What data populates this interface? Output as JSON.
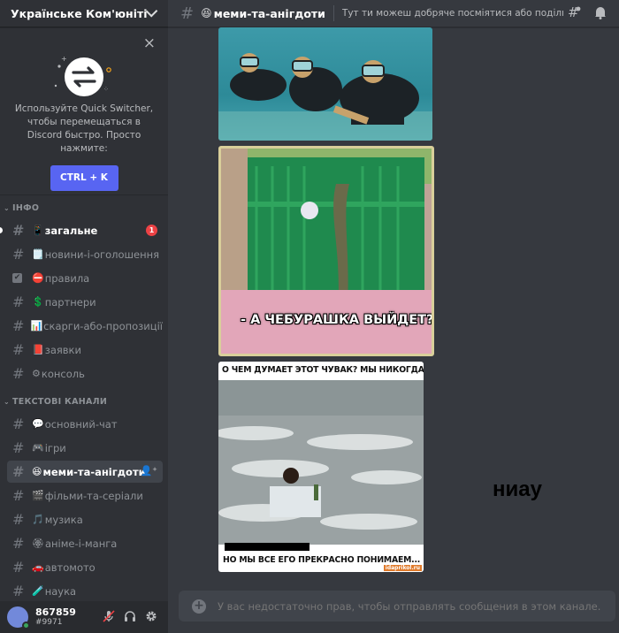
{
  "guild": {
    "name": "Українське Ком'юніті"
  },
  "quick_switcher": {
    "text": "Используйте Quick Switcher, чтобы перемещаться в Discord быстро. Просто нажмите:",
    "button": "CTRL + K",
    "close": "×"
  },
  "categories": [
    {
      "name": "ІНФО",
      "arrow": "⌄"
    },
    {
      "name": "ТЕКСТОВІ КАНАЛИ",
      "arrow": "⌄"
    }
  ],
  "info_channels": [
    {
      "emoji": "📱",
      "name": "загальне",
      "badge": "1"
    },
    {
      "emoji": "🗒️",
      "name": "новини-і-оголошення"
    },
    {
      "emoji": "⛔",
      "name": "правила"
    },
    {
      "emoji": "💲",
      "name": "партнери"
    },
    {
      "emoji": "📊",
      "name": "скарги-або-пропозиції"
    },
    {
      "emoji": "📕",
      "name": "заявки"
    },
    {
      "emoji": "⚙",
      "name": "консоль"
    }
  ],
  "text_channels": [
    {
      "emoji": "💬",
      "name": "основний-чат"
    },
    {
      "emoji": "🎮",
      "name": "ігри"
    },
    {
      "emoji": "😆",
      "name": "меми-та-анігдоти"
    },
    {
      "emoji": "🎬",
      "name": "фільми-та-серіали"
    },
    {
      "emoji": "🎵",
      "name": "музика"
    },
    {
      "emoji": "🏵",
      "name": "аніме-і-манга"
    },
    {
      "emoji": "🚗",
      "name": "автомото"
    },
    {
      "emoji": "🧪",
      "name": "наука"
    }
  ],
  "user": {
    "name": "867859",
    "tag": "#9971"
  },
  "channel_header": {
    "hash": "#",
    "emoji": "😆",
    "name": "меми-та-анігдоти",
    "topic": "Тут ти можеш добряче посміятися або поділитис..."
  },
  "memes": {
    "crocodile_caption": "- А ЧЕБУРАШКА ВЫЙДЕТ?",
    "sea_top": "О ЧЕМ ДУМАЕТ ЭТОТ ЧУВАК? МЫ НИКОГДА НЕ УЗНАЕМ",
    "sea_bottom": "НО МЫ ВСЕ ЕГО ПРЕКРАСНО ПОНИМАЕМ...",
    "sea_watermark": "idaprikol.ru"
  },
  "message_text": "ниау",
  "composer": {
    "placeholder": "У вас недостаточно прав, чтобы отправлять сообщения в этом канале."
  },
  "colors": {
    "accent": "#5865f2",
    "badge": "#ed4245",
    "online": "#3ba55d"
  }
}
